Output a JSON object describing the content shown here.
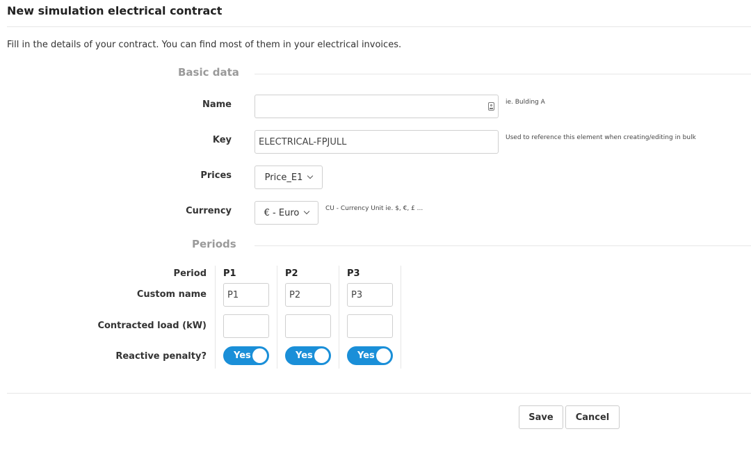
{
  "page": {
    "title": "New simulation electrical contract",
    "intro": "Fill in the details of your contract. You can find most of them in your electrical invoices."
  },
  "basic_data": {
    "section_label": "Basic data",
    "name": {
      "label": "Name",
      "value": "",
      "help": "ie. Bulding A"
    },
    "key": {
      "label": "Key",
      "value": "ELECTRICAL-FPJULL",
      "help": "Used to reference this element when creating/editing in bulk"
    },
    "prices": {
      "label": "Prices",
      "selected": "Price_E1"
    },
    "currency": {
      "label": "Currency",
      "selected": "€ - Euro",
      "help": "CU - Currency Unit ie. $, €, £ ..."
    }
  },
  "periods": {
    "section_label": "Periods",
    "row_labels": {
      "period": "Period",
      "custom_name": "Custom name",
      "contracted_load": "Contracted load (kW)",
      "reactive_penalty": "Reactive penalty?"
    },
    "columns": [
      {
        "period": "P1",
        "custom_name": "P1",
        "contracted_load": "",
        "reactive_penalty": "Yes"
      },
      {
        "period": "P2",
        "custom_name": "P2",
        "contracted_load": "",
        "reactive_penalty": "Yes"
      },
      {
        "period": "P3",
        "custom_name": "P3",
        "contracted_load": "",
        "reactive_penalty": "Yes"
      }
    ]
  },
  "actions": {
    "save_label": "Save",
    "cancel_label": "Cancel"
  },
  "colors": {
    "toggle_on": "#1a8fd8",
    "section_label": "#9a9a9a"
  }
}
